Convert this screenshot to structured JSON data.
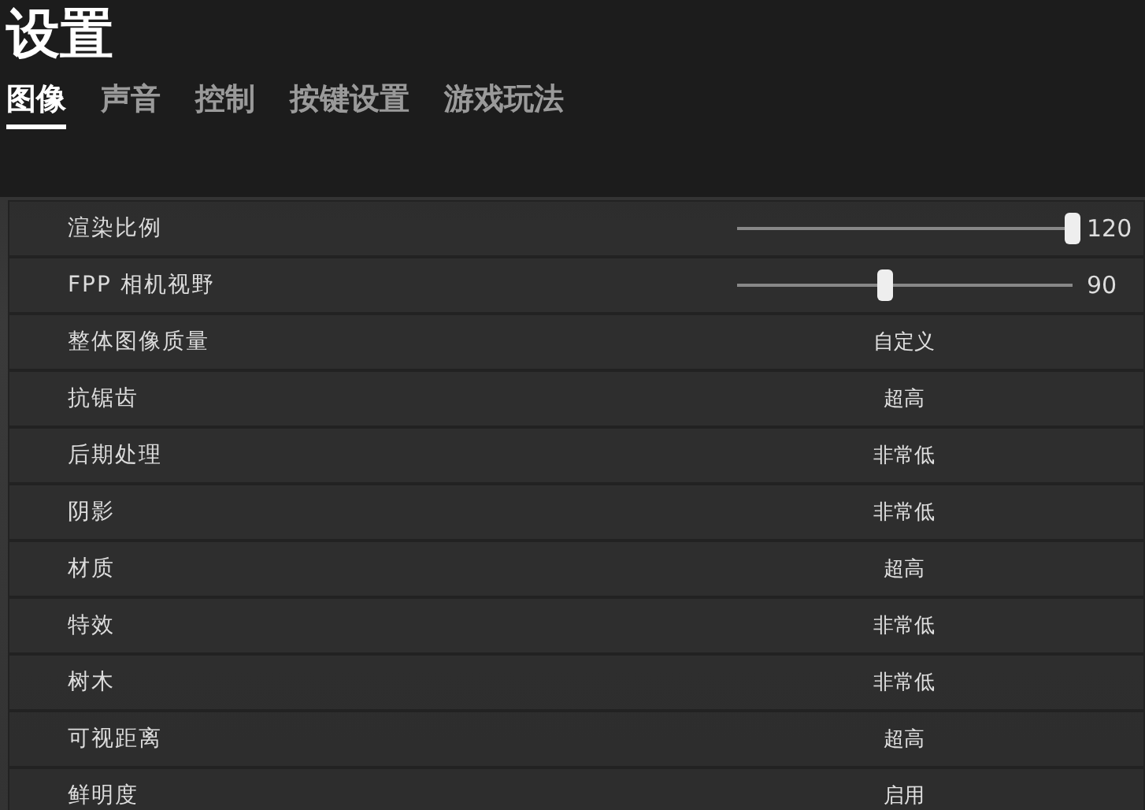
{
  "title": "设置",
  "tabs": [
    {
      "label": "图像",
      "selected": true
    },
    {
      "label": "声音",
      "selected": false
    },
    {
      "label": "控制",
      "selected": false
    },
    {
      "label": "按键设置",
      "selected": false
    },
    {
      "label": "游戏玩法",
      "selected": false
    }
  ],
  "settings": [
    {
      "kind": "slider",
      "label": "渲染比例",
      "level": 1.0,
      "reading": "120"
    },
    {
      "kind": "slider",
      "label": "FPP 相机视野",
      "level": 0.44,
      "reading": "90"
    },
    {
      "kind": "option",
      "label": "整体图像质量",
      "value": "自定义"
    },
    {
      "kind": "option",
      "label": "抗锯齿",
      "value": "超高"
    },
    {
      "kind": "option",
      "label": "后期处理",
      "value": "非常低"
    },
    {
      "kind": "option",
      "label": "阴影",
      "value": "非常低"
    },
    {
      "kind": "option",
      "label": "材质",
      "value": "超高"
    },
    {
      "kind": "option",
      "label": "特效",
      "value": "非常低"
    },
    {
      "kind": "option",
      "label": "树木",
      "value": "非常低"
    },
    {
      "kind": "option",
      "label": "可视距离",
      "value": "超高"
    },
    {
      "kind": "option",
      "label": "鲜明度",
      "value": "启用"
    }
  ]
}
